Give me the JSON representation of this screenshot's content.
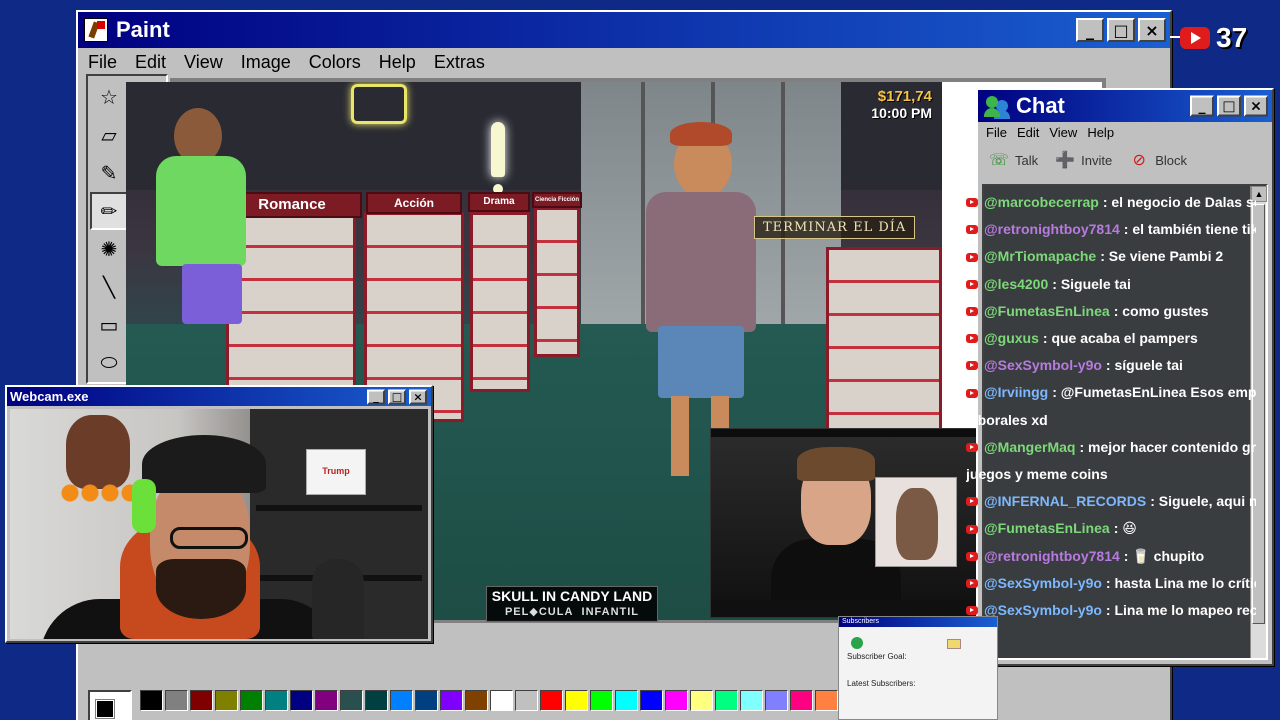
{
  "paint": {
    "title": "Paint",
    "menu": [
      "File",
      "Edit",
      "View",
      "Image",
      "Colors",
      "Help",
      "Extras"
    ],
    "buttons": {
      "minimize": "_",
      "maximize": "□",
      "close": "×"
    },
    "tools": [
      {
        "name": "free-select-icon",
        "glyph": "☆"
      },
      {
        "name": "rect-select-icon",
        "glyph": "⬚"
      },
      {
        "name": "eraser-icon",
        "glyph": "▱"
      },
      {
        "name": "fill-bucket-icon",
        "glyph": "◈"
      },
      {
        "name": "color-picker-icon",
        "glyph": "✎"
      },
      {
        "name": "magnifier-icon",
        "glyph": "🔍"
      },
      {
        "name": "pencil-icon",
        "glyph": "✏"
      },
      {
        "name": "brush-icon",
        "glyph": "🖌"
      },
      {
        "name": "airbrush-icon",
        "glyph": "✺"
      },
      {
        "name": "text-icon",
        "glyph": "A"
      },
      {
        "name": "line-icon",
        "glyph": "╲"
      },
      {
        "name": "curve-icon",
        "glyph": "∫"
      },
      {
        "name": "rectangle-icon",
        "glyph": "▭"
      },
      {
        "name": "polygon-icon",
        "glyph": "⬠"
      },
      {
        "name": "ellipse-icon",
        "glyph": "⬭"
      },
      {
        "name": "rounded-rect-icon",
        "glyph": "▢"
      }
    ],
    "palette": [
      "#000000",
      "#808080",
      "#800000",
      "#808000",
      "#008000",
      "#008080",
      "#000080",
      "#800080",
      "#2a4f4f",
      "#004040",
      "#0080ff",
      "#004080",
      "#8000ff",
      "#804000",
      "#ffffff",
      "#c0c0c0",
      "#ff0000",
      "#ffff00",
      "#00ff00",
      "#00ffff",
      "#0000ff",
      "#ff00ff",
      "#ffff80",
      "#00ff80",
      "#80ffff",
      "#8080ff",
      "#ff0080",
      "#ff8040"
    ]
  },
  "game": {
    "money": "$171,74",
    "time": "10:00 PM",
    "end_day": "TERMINAR EL DÍA",
    "categories": [
      "Romance",
      "Acción",
      "Drama",
      "Ciencia Ficción"
    ],
    "caption_title": "SKULL IN CANDY LAND",
    "caption_sub_left": "PEL",
    "caption_sub_mid": "CULA",
    "caption_sub_right": "INFANTIL"
  },
  "chat": {
    "title": "Chat",
    "menu": [
      "File",
      "Edit",
      "View",
      "Help"
    ],
    "toolbar": [
      {
        "label": "Talk",
        "icon": "talk-icon",
        "glyph": "☏"
      },
      {
        "label": "Invite",
        "icon": "invite-icon",
        "glyph": "➕"
      },
      {
        "label": "Block",
        "icon": "block-icon",
        "glyph": "⊘"
      }
    ],
    "messages": [
      {
        "user": "@marcobecerrap",
        "color": "#7dd87a",
        "text": ": el negocio de Dalas son l"
      },
      {
        "user": "@retronightboy7814",
        "color": "#b77ae0",
        "text": ": el también tiene tikto"
      },
      {
        "user": "@MrTiomapache",
        "color": "#7dd87a",
        "text": ": Se viene Pambi 2"
      },
      {
        "user": "@les4200",
        "color": "#7dd87a",
        "text": ": Siguele tai"
      },
      {
        "user": "@FumetasEnLinea",
        "color": "#7dd87a",
        "text": ": como gustes"
      },
      {
        "user": "@guxus",
        "color": "#7dd87a",
        "text": ": que acaba el pampers"
      },
      {
        "user": "@SexSymbol-y9o",
        "color": "#b77ae0",
        "text": ": síguele tai"
      },
      {
        "user": "@Irviingg",
        "color": "#7db8ff",
        "text": ": @FumetasEnLinea Esos emplead"
      },
      {
        "user": "",
        "color": "#ffffff",
        "text": "laborales xd",
        "cont": true
      },
      {
        "user": "@MangerMaq",
        "color": "#7dd87a",
        "text": ": mejor hacer contenido grati"
      },
      {
        "user": "",
        "color": "#ffffff",
        "text": "juegos y meme coins",
        "cont": true
      },
      {
        "user": "@INFERNAL_RECORDS",
        "color": "#7db8ff",
        "text": ": Siguele, aqui nos c"
      },
      {
        "user": "@FumetasEnLinea",
        "color": "#7dd87a",
        "text": ": 😆"
      },
      {
        "user": "@retronightboy7814",
        "color": "#b77ae0",
        "text": ": 🥛 chupito"
      },
      {
        "user": "@SexSymbol-y9o",
        "color": "#7db8ff",
        "text": ": hasta Lina me lo crítico :"
      },
      {
        "user": "@SexSymbol-y9o",
        "color": "#7db8ff",
        "text": ": Lina me lo mapeo recio"
      }
    ]
  },
  "webcam": {
    "title": "Webcam.exe",
    "roll_label": "Trump"
  },
  "subs": {
    "title": "Subscribers",
    "goal": "Subscriber Goal:",
    "latest": "Latest Subscribers:"
  },
  "youtube": {
    "count": "37"
  }
}
